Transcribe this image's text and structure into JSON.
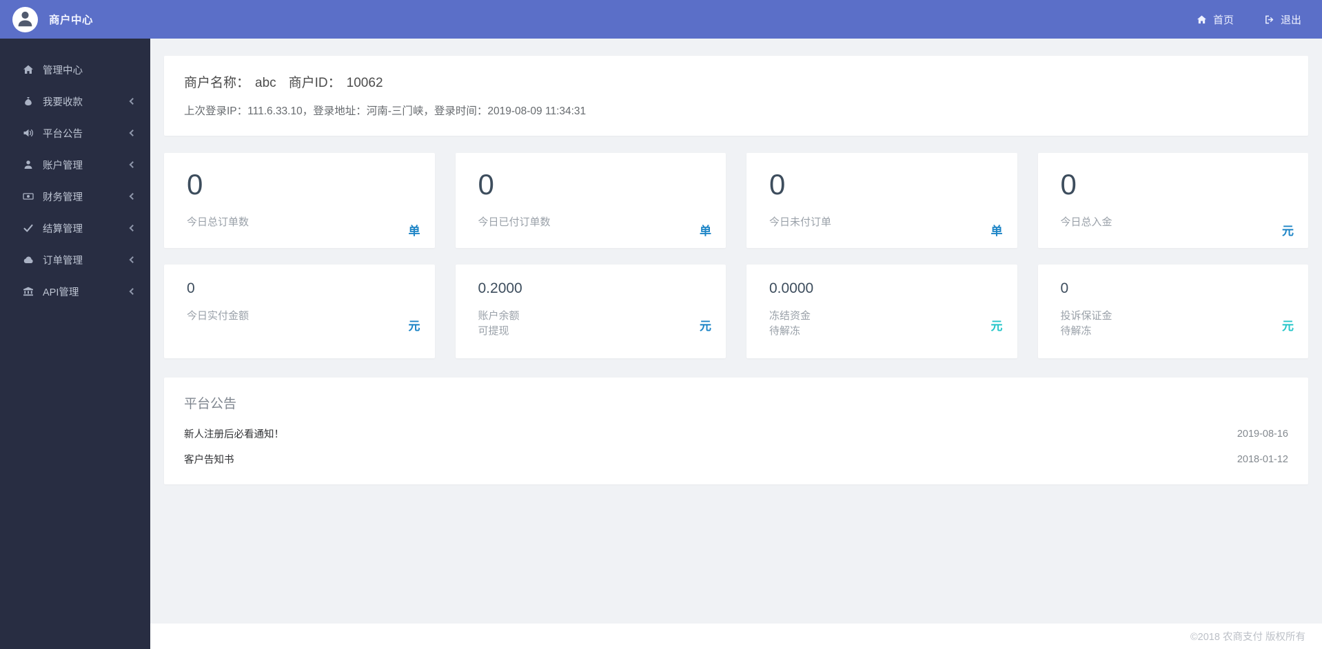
{
  "navbar": {
    "brand": "商户中心",
    "home_label": "首页",
    "logout_label": "退出"
  },
  "sidebar": {
    "items": [
      {
        "label": "管理中心",
        "icon": "home-icon",
        "has_submenu": false
      },
      {
        "label": "我要收款",
        "icon": "receive-payment-icon",
        "has_submenu": true
      },
      {
        "label": "平台公告",
        "icon": "announcement-icon",
        "has_submenu": true
      },
      {
        "label": "账户管理",
        "icon": "user-icon",
        "has_submenu": true
      },
      {
        "label": "财务管理",
        "icon": "finance-icon",
        "has_submenu": true
      },
      {
        "label": "结算管理",
        "icon": "settlement-check-icon",
        "has_submenu": true
      },
      {
        "label": "订单管理",
        "icon": "order-cloud-icon",
        "has_submenu": true
      },
      {
        "label": "API管理",
        "icon": "api-bank-icon",
        "has_submenu": true
      }
    ]
  },
  "merchant_info": {
    "name_label": "商户名称：",
    "name": "abc",
    "id_label": "商户ID：",
    "id": "10062",
    "login_line": "上次登录IP：111.6.33.10，登录地址：河南-三门峡，登录时间：2019-08-09 11:34:31"
  },
  "stats_row1": [
    {
      "value": "0",
      "label": "今日总订单数",
      "unit": "单"
    },
    {
      "value": "0",
      "label": "今日已付订单数",
      "unit": "单"
    },
    {
      "value": "0",
      "label": "今日未付订单",
      "unit": "单"
    },
    {
      "value": "0",
      "label": "今日总入金",
      "unit": "元"
    }
  ],
  "stats_row2": [
    {
      "value": "0",
      "label": "今日实付金额",
      "sublabel": "",
      "unit": "元"
    },
    {
      "value": "0.2000",
      "label": "账户余额",
      "sublabel": "可提现",
      "unit": "元"
    },
    {
      "value": "0.0000",
      "label": "冻结资金",
      "sublabel": "待解冻",
      "unit": "元"
    },
    {
      "value": "0",
      "label": "投诉保证金",
      "sublabel": "待解冻",
      "unit": "元"
    }
  ],
  "announcements": {
    "title": "平台公告",
    "items": [
      {
        "title": "新人注册后必看通知！",
        "date": "2019-08-16"
      },
      {
        "title": "客户告知书",
        "date": "2018-01-12"
      }
    ]
  },
  "footer": {
    "copyright": "©2018 农商支付 版权所有"
  },
  "colors": {
    "navbar_bg": "#5b6fc8",
    "sidebar_bg": "#282d42",
    "main_bg": "#f0f2f5",
    "stat_value": "#3d4d5d",
    "unit_blue": "#1c84c6",
    "unit_teal": "#26c6c9"
  },
  "icons": {
    "navbar": [
      "user-avatar-icon",
      "home-icon",
      "sign-out-icon"
    ],
    "sidebar_chevron": "angle-left"
  }
}
